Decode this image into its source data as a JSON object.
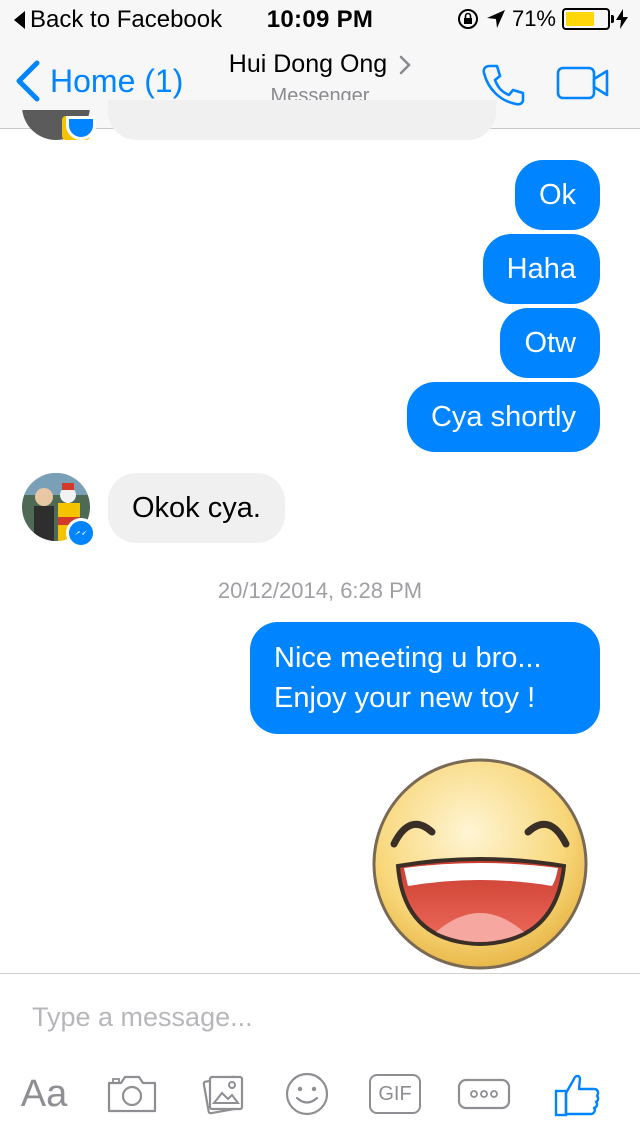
{
  "status_bar": {
    "back_app": "Back to Facebook",
    "time": "10:09 PM",
    "battery": "71%",
    "battery_level": 0.71
  },
  "navbar": {
    "back_label": "Home (1)",
    "contact_name": "Hui Dong Ong",
    "subtitle": "Messenger"
  },
  "messages": [
    {
      "from": "me",
      "text": "Ok"
    },
    {
      "from": "me",
      "text": "Haha"
    },
    {
      "from": "me",
      "text": "Otw"
    },
    {
      "from": "me",
      "text": "Cya shortly"
    },
    {
      "from": "them",
      "text": "Okok cya."
    },
    {
      "from": "me",
      "text": "Nice meeting u bro... Enjoy your new toy !"
    }
  ],
  "timestamp": "20/12/2014, 6:28 PM",
  "sticker": "laughing-face-sticker",
  "composer": {
    "placeholder": "Type a message...",
    "tools": [
      "Aa",
      "camera-icon",
      "photo-icon",
      "emoji-icon",
      "GIF",
      "more-icon",
      "like-icon"
    ]
  },
  "colors": {
    "accent": "#0084ff",
    "incoming_bubble": "#f1f0f0",
    "header_bg": "#f7f7f8"
  }
}
